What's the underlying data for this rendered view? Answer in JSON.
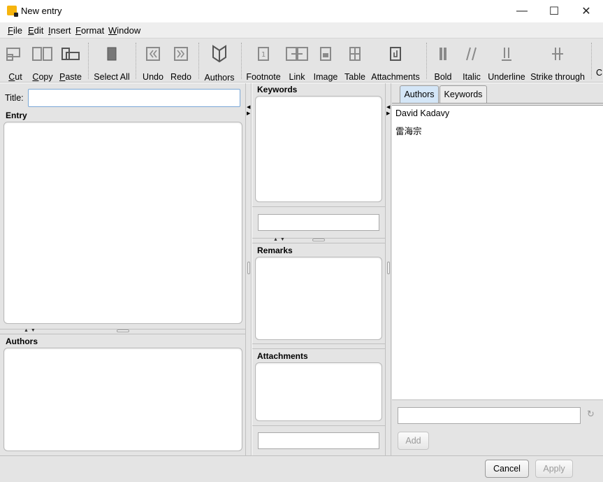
{
  "window": {
    "title": "New entry",
    "minimize": "—",
    "maximize": "☐",
    "close": "✕"
  },
  "menu": [
    "File",
    "Edit",
    "Insert",
    "Format",
    "Window"
  ],
  "toolbar": {
    "cut": "Cut",
    "copy": "Copy",
    "paste": "Paste",
    "select_all": "Select All",
    "undo": "Undo",
    "redo": "Redo",
    "authors": "Authors",
    "footnote": "Footnote",
    "link": "Link",
    "image": "Image",
    "table": "Table",
    "attachments": "Attachments",
    "bold": "Bold",
    "italic": "Italic",
    "underline": "Underline",
    "strike": "Strike through",
    "overflow": "C"
  },
  "entry_pane": {
    "title_label": "Title:",
    "title_value": "",
    "entry_heading": "Entry",
    "authors_heading": "Authors"
  },
  "middle_pane": {
    "keywords_heading": "Keywords",
    "remarks_heading": "Remarks",
    "attachments_heading": "Attachments"
  },
  "right_pane": {
    "tabs": [
      "Authors",
      "Keywords"
    ],
    "active_tab": "Authors",
    "authors": [
      "David Kadavy",
      "雷海宗"
    ],
    "add_input_value": "",
    "add_button": "Add"
  },
  "footer": {
    "cancel": "Cancel",
    "apply": "Apply"
  },
  "colors": {
    "toolbar_bg": "#e4e4e4",
    "active_tab": "#d4e6f7",
    "icon_gray": "#8a8a8a"
  }
}
